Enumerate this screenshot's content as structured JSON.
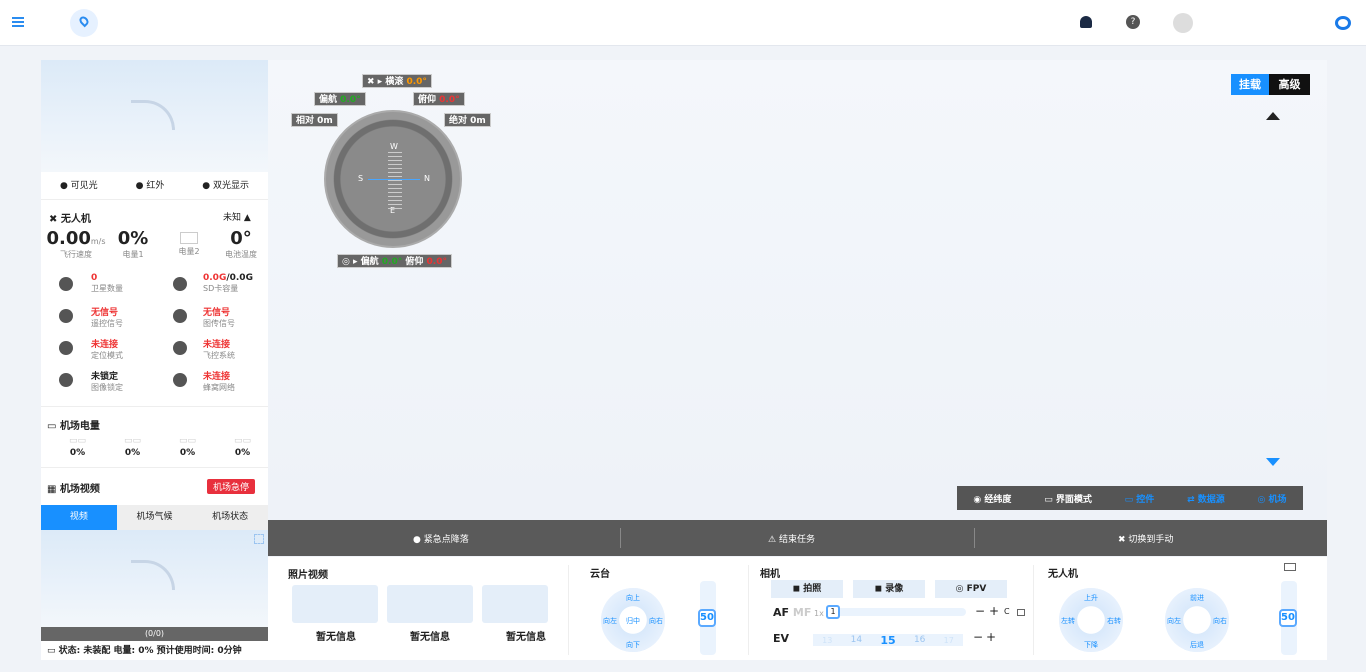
{
  "top": {
    "menu_icon": "menu-icon",
    "location_icon": "location-icon",
    "bell": "bell-icon",
    "help": "help-icon",
    "avatar": "avatar-icon",
    "logo": "brand-logo"
  },
  "left": {
    "tabs_mode": [
      "可见光",
      "红外",
      "双光显示"
    ],
    "drone_title": "无人机",
    "drone_status": "未知",
    "stats": [
      {
        "value": "0.00",
        "unit": "m/s",
        "label": "飞行速度"
      },
      {
        "value": "0%",
        "unit": "",
        "label": "电量1"
      },
      {
        "value": "",
        "unit": "",
        "label": "电量2"
      },
      {
        "value": "0°",
        "unit": "",
        "label": "电池温度"
      }
    ],
    "info": [
      {
        "v": "0",
        "l": "卫星数量",
        "red": true
      },
      {
        "v": "0.0G",
        "v2": "/0.0G",
        "l": "SD卡容量",
        "red": true
      },
      {
        "v": "无信号",
        "l": "遥控信号",
        "red": true
      },
      {
        "v": "无信号",
        "l": "图传信号",
        "red": true
      },
      {
        "v": "未连接",
        "l": "定位模式",
        "red": true
      },
      {
        "v": "未连接",
        "l": "飞控系统",
        "red": true
      },
      {
        "v": "未锁定",
        "l": "图像锁定",
        "red": false
      },
      {
        "v": "未连接",
        "l": "蜂窝网络",
        "red": true
      }
    ],
    "dock_power_title": "机场电量",
    "dock_power": [
      "0%",
      "0%",
      "0%",
      "0%"
    ],
    "dock_video_title": "机场视频",
    "estop": "机场急停",
    "video_tabs": [
      "视频",
      "机场气候",
      "机场状态"
    ],
    "video_counter": "(0/0)",
    "status_line": "状态: 未装配  电量: 0%  预计使用时间: 0分钟"
  },
  "hud": {
    "roll_label": "横滚",
    "roll_val": "0.0°",
    "yaw_label": "偏航",
    "yaw_val": "0.0°",
    "pitch_label": "俯仰",
    "pitch_val": "0.0°",
    "rel": "相对 0m",
    "abs": "绝对 0m",
    "compass": [
      "W",
      "S",
      "N",
      "E"
    ],
    "gimbal_yaw_label": "偏航",
    "gimbal_yaw_val": "0.0°",
    "gimbal_pitch_label": "俯仰",
    "gimbal_pitch_val": "0.0°"
  },
  "right": {
    "tab1": "挂载",
    "tab2": "高级"
  },
  "map_tools": [
    "经纬度",
    "界面模式",
    "控件",
    "数据源",
    "机场"
  ],
  "ctl": [
    "紧急点降落",
    "结束任务",
    "切换到手动"
  ],
  "bottom": {
    "photo_title": "照片视频",
    "photos": [
      "暂无信息",
      "暂无信息",
      "暂无信息"
    ],
    "gimbal_title": "云台",
    "gimbal_pad": [
      "向上",
      "向左",
      "归中",
      "向右",
      "向下"
    ],
    "gimbal_speed": "50",
    "camera_title": "相机",
    "cam_btns": [
      "拍照",
      "录像",
      "FPV"
    ],
    "af": "AF",
    "mf": "MF",
    "zoom": "1x",
    "zoom_val": "1",
    "cmode": "C",
    "ev": "EV",
    "ev_ticks": [
      "13",
      "14",
      "15",
      "16",
      "17"
    ],
    "drone_title": "无人机",
    "pad1": [
      "上升",
      "左转",
      "右转",
      "下降"
    ],
    "pad2": [
      "前进",
      "向左",
      "向右",
      "后退"
    ],
    "drone_speed": "50"
  }
}
